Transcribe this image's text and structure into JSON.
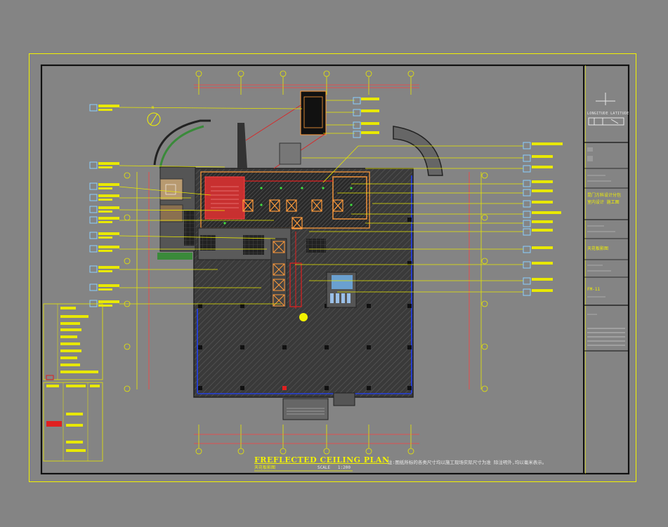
{
  "drawing": {
    "title": "FREFLECTED CEILING  PLAN",
    "subtitle": "天花板影图",
    "scale_label": "SCALE",
    "scale_value": "1:200",
    "note": "注:图纸所标的各类尺寸均以施工现场实际尺寸为准  除注明外,均以毫米表示。",
    "north_mark": "N"
  },
  "title_block": {
    "brand": "LONGITUDE LATITUDE",
    "description_line1": "昆门方科设计分包",
    "description_line2": "室内设计   施工图",
    "drawing_name": "天花板影图",
    "sheet_number": "FM-11"
  },
  "colors": {
    "background": "#848484",
    "frame_yellow": "#f2f200",
    "sheet_black": "#1a1a1a",
    "hatch_gray": "#4a4a4a",
    "accent_red": "#e02020",
    "accent_blue": "#2040ff",
    "accent_orange": "#ff9a3a",
    "leader_yellow": "#e8e800"
  }
}
